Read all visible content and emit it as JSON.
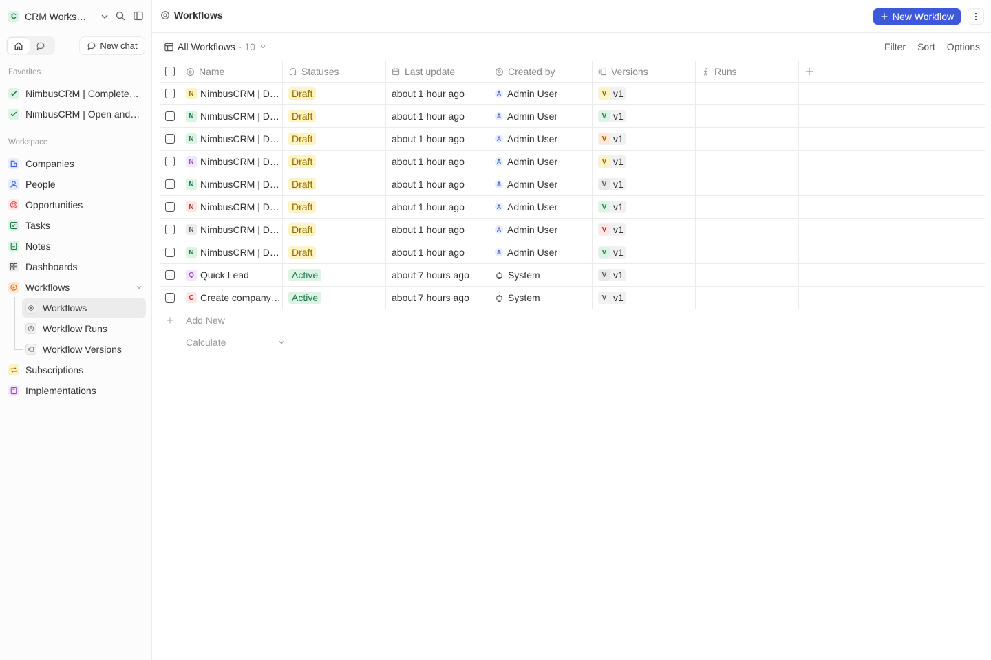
{
  "workspace": {
    "logo": "C",
    "name": "CRM Workspace"
  },
  "sidebar": {
    "new_chat": "New chat",
    "favorites_label": "Favorites",
    "favorites": [
      {
        "label": "NimbusCRM | Completed Deals",
        "icon": "checklist-icon"
      },
      {
        "label": "NimbusCRM | Open and Pending",
        "icon": "checklist-icon"
      }
    ],
    "workspace_label": "Workspace",
    "items": [
      {
        "label": "Companies",
        "icon": "building-icon",
        "color": "#3e63dd",
        "bg": "#e6ecfe"
      },
      {
        "label": "People",
        "icon": "user-icon",
        "color": "#3e63dd",
        "bg": "#e6ecfe"
      },
      {
        "label": "Opportunities",
        "icon": "target-icon",
        "color": "#e5484d",
        "bg": "#fde8e8"
      },
      {
        "label": "Tasks",
        "icon": "checkbox-icon",
        "color": "#18794e",
        "bg": "#ddf3e4"
      },
      {
        "label": "Notes",
        "icon": "note-icon",
        "color": "#18794e",
        "bg": "#ddf3e4"
      },
      {
        "label": "Dashboards",
        "icon": "grid-icon",
        "color": "#555",
        "bg": "#f1f1f1"
      },
      {
        "label": "Workflows",
        "icon": "settings-automation-icon",
        "color": "#f76808",
        "bg": "#ffe8d7"
      }
    ],
    "sub_items": [
      {
        "label": "Workflows",
        "icon": "settings-automation-icon"
      },
      {
        "label": "Workflow Runs",
        "icon": "history-icon"
      },
      {
        "label": "Workflow Versions",
        "icon": "versions-icon"
      }
    ],
    "bottom_items": [
      {
        "label": "Subscriptions",
        "icon": "repeat-icon",
        "color": "#ad5700",
        "bg": "#fdf4c3"
      },
      {
        "label": "Implementations",
        "icon": "book-icon",
        "color": "#8e4ec6",
        "bg": "#f3e7fc"
      }
    ]
  },
  "header": {
    "title": "Workflows",
    "new_button": "New Workflow"
  },
  "view": {
    "name": "All Workflows",
    "count": "· 10",
    "filter": "Filter",
    "sort": "Sort",
    "options": "Options"
  },
  "table": {
    "columns": [
      "Name",
      "Statuses",
      "Last update",
      "Created by",
      "Versions",
      "Runs"
    ],
    "rows": [
      {
        "initial": "N",
        "name": "NimbusCRM | Draft Workflow",
        "status": "Draft",
        "updated": "about 1 hour ago",
        "by": "Admin User",
        "by_initial": "A",
        "ver_initial": "V",
        "version": "v1",
        "color": "#946800",
        "bg": "#fdf4c3",
        "ver_color": "#946800",
        "ver_bg": "#fdf4c3"
      },
      {
        "initial": "N",
        "name": "NimbusCRM | Draft Workflow",
        "status": "Draft",
        "updated": "about 1 hour ago",
        "by": "Admin User",
        "by_initial": "A",
        "ver_initial": "V",
        "version": "v1",
        "color": "#18794e",
        "bg": "#ddf3e4",
        "ver_color": "#18794e",
        "ver_bg": "#ddf3e4"
      },
      {
        "initial": "N",
        "name": "NimbusCRM | Draft Workflow",
        "status": "Draft",
        "updated": "about 1 hour ago",
        "by": "Admin User",
        "by_initial": "A",
        "ver_initial": "V",
        "version": "v1",
        "color": "#18794e",
        "bg": "#ddf3e4",
        "ver_color": "#ad5700",
        "ver_bg": "#ffe8d7"
      },
      {
        "initial": "N",
        "name": "NimbusCRM | Draft Workflow",
        "status": "Draft",
        "updated": "about 1 hour ago",
        "by": "Admin User",
        "by_initial": "A",
        "ver_initial": "V",
        "version": "v1",
        "color": "#8e4ec6",
        "bg": "#f3e7fc",
        "ver_color": "#946800",
        "ver_bg": "#fdf4c3"
      },
      {
        "initial": "N",
        "name": "NimbusCRM | Draft Workflow",
        "status": "Draft",
        "updated": "about 1 hour ago",
        "by": "Admin User",
        "by_initial": "A",
        "ver_initial": "V",
        "version": "v1",
        "color": "#18794e",
        "bg": "#ddf3e4",
        "ver_color": "#555",
        "ver_bg": "#e8e8e8"
      },
      {
        "initial": "N",
        "name": "NimbusCRM | Draft Workflow",
        "status": "Draft",
        "updated": "about 1 hour ago",
        "by": "Admin User",
        "by_initial": "A",
        "ver_initial": "V",
        "version": "v1",
        "color": "#cd2b31",
        "bg": "#fde8e8",
        "ver_color": "#18794e",
        "ver_bg": "#ddf3e4"
      },
      {
        "initial": "N",
        "name": "NimbusCRM | Draft Workflow",
        "status": "Draft",
        "updated": "about 1 hour ago",
        "by": "Admin User",
        "by_initial": "A",
        "ver_initial": "V",
        "version": "v1",
        "color": "#555",
        "bg": "#ececec",
        "ver_color": "#cd2b31",
        "ver_bg": "#fde8e8"
      },
      {
        "initial": "N",
        "name": "NimbusCRM | Draft Workflow",
        "status": "Draft",
        "updated": "about 1 hour ago",
        "by": "Admin User",
        "by_initial": "A",
        "ver_initial": "V",
        "version": "v1",
        "color": "#18794e",
        "bg": "#ddf3e4",
        "ver_color": "#18794e",
        "ver_bg": "#ddf3e4"
      },
      {
        "initial": "Q",
        "name": "Quick Lead",
        "status": "Active",
        "updated": "about 7 hours ago",
        "by": "System",
        "by_initial": "",
        "ver_initial": "V",
        "version": "v1",
        "color": "#8e4ec6",
        "bg": "#f3e7fc",
        "ver_color": "#555",
        "ver_bg": "#e8e8e8"
      },
      {
        "initial": "C",
        "name": "Create company when adding a new person",
        "status": "Active",
        "updated": "about 7 hours ago",
        "by": "System",
        "by_initial": "",
        "ver_initial": "V",
        "version": "v1",
        "color": "#cd2b31",
        "bg": "#fde8e8",
        "ver_color": "#555",
        "ver_bg": "#f1f1f1"
      }
    ],
    "add_new": "Add New",
    "calculate": "Calculate"
  }
}
